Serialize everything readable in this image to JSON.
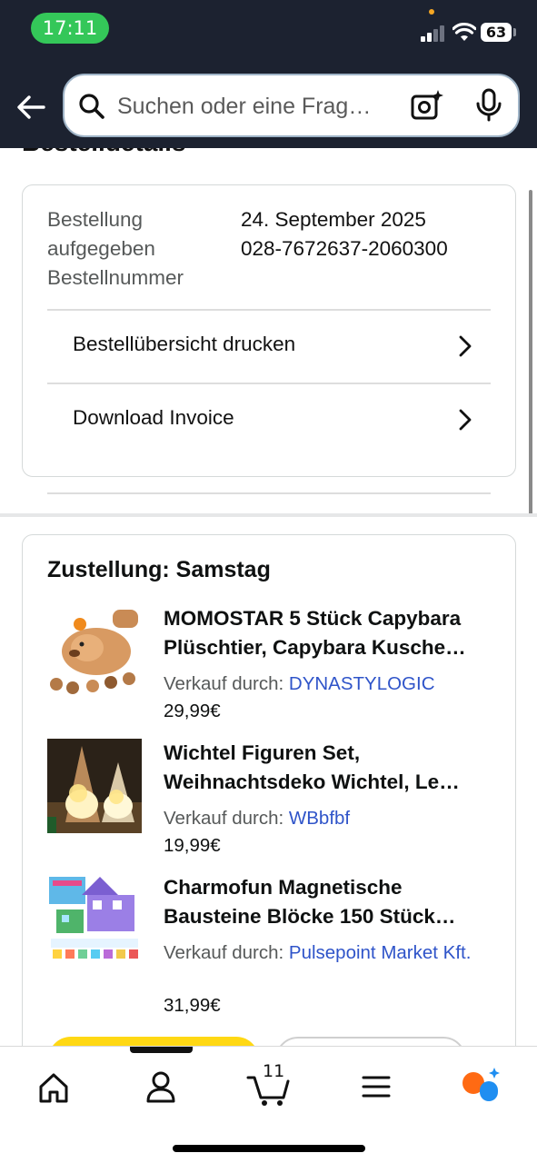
{
  "status_bar": {
    "time": "17:11",
    "battery": "63"
  },
  "search": {
    "placeholder": "Suchen oder eine Frag…"
  },
  "page": {
    "title_cut": "Bestelldetails"
  },
  "order_info": {
    "labels": "Bestellung aufgegeben Bestellnummer",
    "date": "24. September 2025",
    "number": "028-7672637-2060300",
    "print_summary": "Bestellübersicht drucken",
    "download_invoice": "Download Invoice"
  },
  "delivery": {
    "title": "Zustellung: Samstag",
    "seller_prefix": "Verkauf durch: ",
    "items": [
      {
        "name": "MOMOSTAR 5 Stück Capybara Plüschtier, Capybara Kusche…",
        "seller": "DYNASTYLOGIC",
        "price": "29,99€"
      },
      {
        "name": "Wichtel Figuren Set, Weihnachtsdeko Wichtel, Le…",
        "seller": "WBbfbf",
        "price": "19,99€"
      },
      {
        "name": "Charmofun Magnetische Bausteine Blöcke 150 Stück…",
        "seller": "Pulsepoint Market Kft.",
        "price": "31,99€"
      }
    ]
  },
  "bottom_nav": {
    "cart_count": "11",
    "items": [
      "home-icon",
      "account-icon",
      "cart-icon",
      "menu-icon",
      "rufus-icon"
    ]
  },
  "colors": {
    "header_bg": "#1c2230",
    "status_green": "#34c759",
    "seller_link": "#2f54c9",
    "button_yellow": "#ffd814",
    "assistant_orange": "#ff6a13",
    "assistant_blue": "#1f8ef1"
  }
}
